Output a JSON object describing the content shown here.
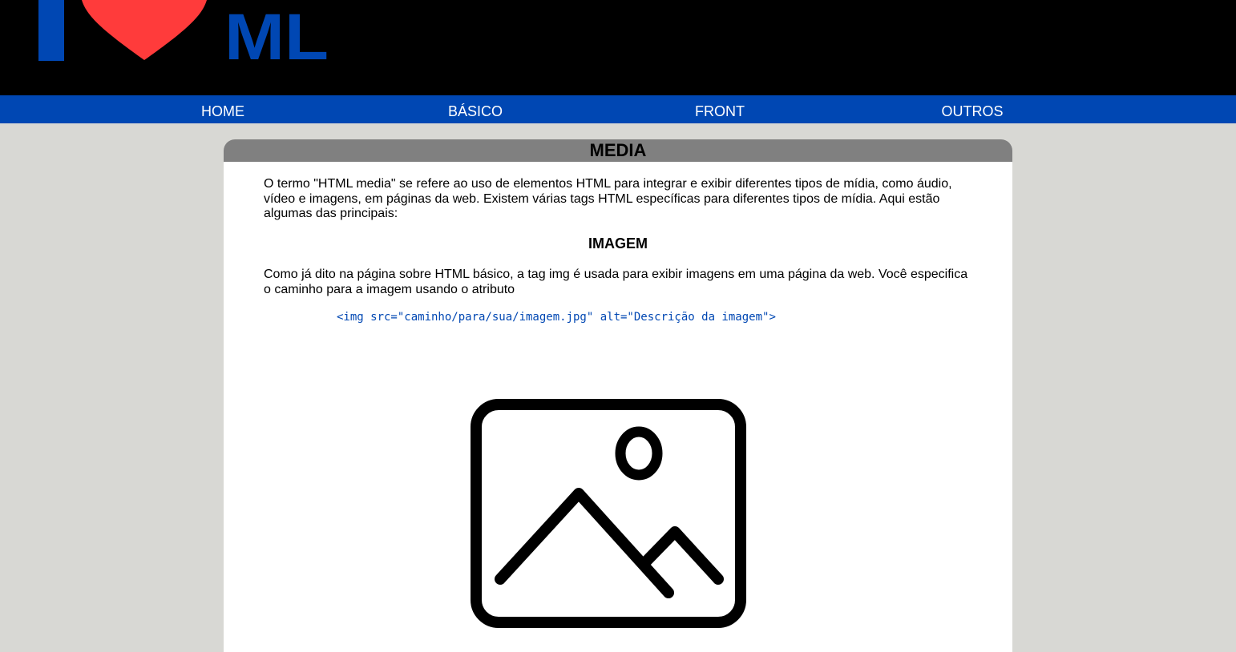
{
  "colors": {
    "header_bg": "#000000",
    "nav_bg": "#0047b3",
    "logo_blue": "#0047b3",
    "heart_red": "#ff3b3b",
    "page_bg": "#d8d8d4",
    "title_bar_bg": "#808080",
    "code_color": "#0047b3"
  },
  "logo": {
    "text": "ML",
    "icons": [
      "i-bar",
      "heart-icon"
    ]
  },
  "nav": {
    "items": [
      {
        "label": "HOME"
      },
      {
        "label": "BÁSICO"
      },
      {
        "label": "FRONT"
      },
      {
        "label": "OUTROS"
      }
    ]
  },
  "main": {
    "title": "MEDIA",
    "intro": "O termo \"HTML media\" se refere ao uso de elementos HTML para integrar e exibir diferentes tipos de mídia, como áudio, vídeo e imagens, em páginas da web. Existem várias tags HTML específicas para diferentes tipos de mídia. Aqui estão algumas das principais:",
    "section": {
      "heading": "IMAGEM",
      "text": "Como já dito na página sobre HTML básico, a tag img é usada para exibir imagens em uma página da web. Você especifica o caminho para a imagem usando o atributo",
      "code": "<img src=\"caminho/para/sua/imagem.jpg\" alt=\"Descrição da imagem\">",
      "illustration": "image-placeholder-icon"
    }
  }
}
